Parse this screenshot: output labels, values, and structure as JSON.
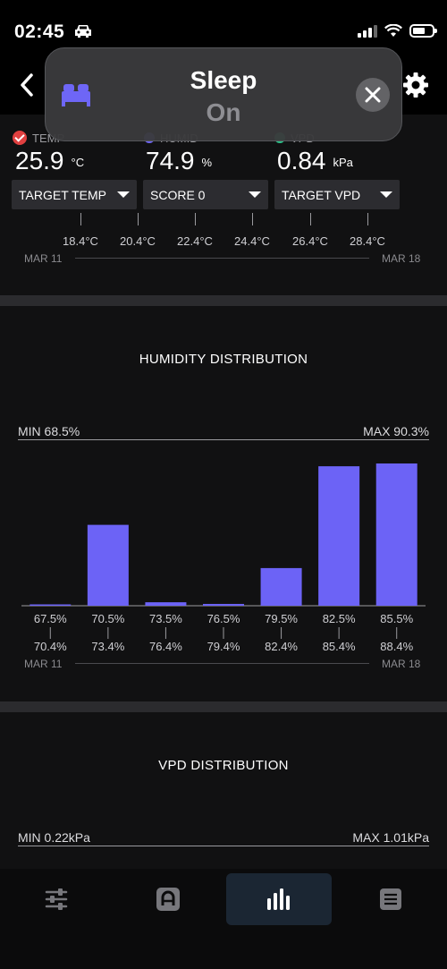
{
  "status": {
    "time": "02:45"
  },
  "sleep": {
    "title": "Sleep",
    "subtitle": "On"
  },
  "readings": [
    {
      "label": "TEMP",
      "value": "25.9",
      "unit": "°C"
    },
    {
      "label": "HUMID",
      "value": "74.9",
      "unit": "%"
    },
    {
      "label": "VPD",
      "value": "0.84",
      "unit": "kPa"
    }
  ],
  "selectors": [
    "TARGET TEMP",
    "SCORE 0",
    "TARGET VPD"
  ],
  "temp_axis": {
    "lower_labels": [
      "18.4°C",
      "20.4°C",
      "22.4°C",
      "24.4°C",
      "26.4°C",
      "28.4°C"
    ],
    "start_date": "MAR 11",
    "end_date": "MAR 18"
  },
  "humidity": {
    "title": "HUMIDITY DISTRIBUTION",
    "min_label": "MIN 68.5%",
    "max_label": "MAX 90.3%",
    "start_date": "MAR 11",
    "end_date": "MAR 18"
  },
  "vpd": {
    "title": "VPD DISTRIBUTION",
    "min_label": "MIN 0.22kPa",
    "max_label": "MAX 1.01kPa"
  },
  "colors": {
    "accent": "#6C63F6",
    "active_nav": "#1B2633",
    "background": "#111112"
  },
  "nav": [
    "sliders-icon",
    "auto-icon",
    "stats-icon",
    "menu-icon"
  ],
  "chart_data": {
    "type": "bar",
    "title": "HUMIDITY DISTRIBUTION",
    "categories": [
      "67.5%",
      "70.5%",
      "73.5%",
      "76.5%",
      "79.5%",
      "82.5%",
      "85.5%"
    ],
    "category_ends": [
      "70.4%",
      "73.4%",
      "76.4%",
      "79.4%",
      "82.4%",
      "85.4%",
      "88.4%"
    ],
    "values": [
      0.7,
      58,
      2.5,
      1.3,
      27,
      100,
      102
    ],
    "ylim": [
      0,
      102
    ],
    "grid": false,
    "legend": "none"
  }
}
